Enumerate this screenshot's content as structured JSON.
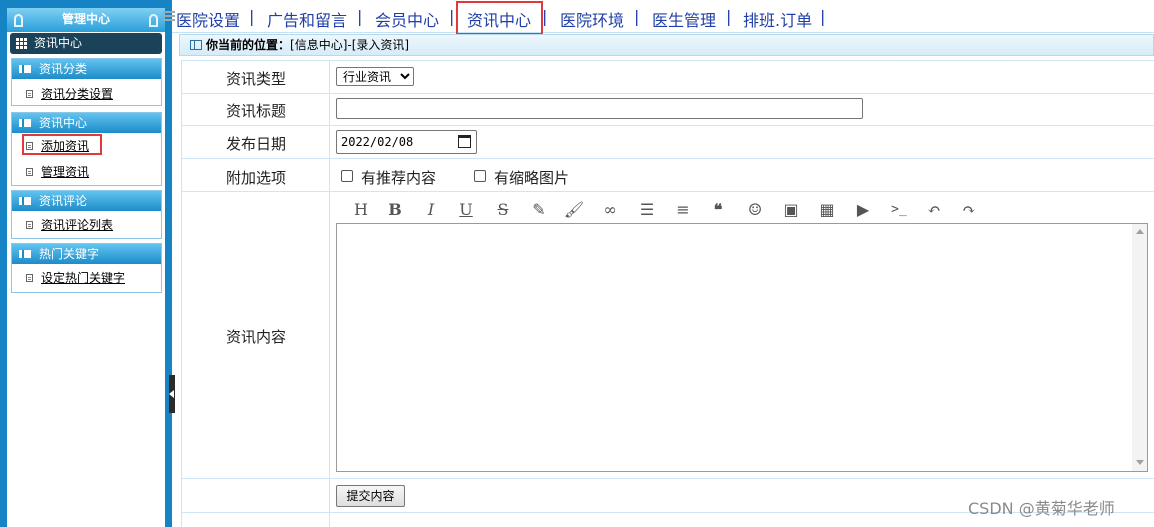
{
  "sidebar": {
    "title": "管理中心",
    "section": "资讯中心",
    "groups": [
      {
        "title": "资讯分类",
        "items": [
          "资讯分类设置"
        ]
      },
      {
        "title": "资讯中心",
        "items": [
          "添加资讯",
          "管理资讯"
        ]
      },
      {
        "title": "资讯评论",
        "items": [
          "资讯评论列表"
        ]
      },
      {
        "title": "热门关键字",
        "items": [
          "设定热门关键字"
        ]
      }
    ]
  },
  "nav": {
    "items": [
      "医院设置",
      "广告和留言",
      "会员中心",
      "资讯中心",
      "医院环境",
      "医生管理",
      "排班.订单"
    ],
    "separator": "|",
    "active": "资讯中心"
  },
  "breadcrumb": {
    "prefix": "你当前的位置：",
    "path": "[信息中心]-[录入资讯]"
  },
  "form": {
    "type_label": "资讯类型",
    "type_value": "行业资讯",
    "title_label": "资讯标题",
    "title_value": "",
    "date_label": "发布日期",
    "date_value": "2022/02/08",
    "options_label": "附加选项",
    "option1": "有推荐内容",
    "option2": "有缩略图片",
    "content_label": "资讯内容",
    "submit_label": "提交内容"
  },
  "toolbar_icons": [
    "heading-icon",
    "bold-icon",
    "italic-icon",
    "underline-icon",
    "strikethrough-icon",
    "highlighter-icon",
    "brush-icon",
    "link-icon",
    "list-icon",
    "align-icon",
    "quote-icon",
    "emoji-icon",
    "image-icon",
    "table-icon",
    "video-icon",
    "code-icon",
    "undo-icon",
    "redo-icon"
  ],
  "watermark": "CSDN @黄菊华老师",
  "colors": {
    "sidebar_bg": "#1683c4",
    "nav_text": "#1f3fa8",
    "highlight": "#e23a3a"
  }
}
